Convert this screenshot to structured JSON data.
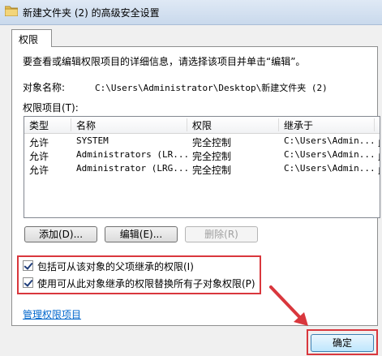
{
  "window": {
    "title": "新建文件夹 (2) 的高级安全设置"
  },
  "tabs": [
    {
      "label": "权限"
    }
  ],
  "instructions": "要查看或编辑权限项目的详细信息，请选择该项目并单击“编辑”。",
  "object_name": {
    "label": "对象名称:",
    "value": "C:\\Users\\Administrator\\Desktop\\新建文件夹 (2)"
  },
  "permission_entries_label": "权限项目(T):",
  "table": {
    "columns": [
      "类型",
      "名称",
      "权限",
      "继承于",
      "应"
    ],
    "rows": [
      {
        "type": "允许",
        "name": "SYSTEM",
        "permission": "完全控制",
        "inherited": "C:\\Users\\Admin...",
        "apply": "此"
      },
      {
        "type": "允许",
        "name": "Administrators (LR...",
        "permission": "完全控制",
        "inherited": "C:\\Users\\Admin...",
        "apply": "此"
      },
      {
        "type": "允许",
        "name": "Administrator (LRG...",
        "permission": "完全控制",
        "inherited": "C:\\Users\\Admin...",
        "apply": "此"
      }
    ]
  },
  "buttons": {
    "add": "添加(D)...",
    "edit": "编辑(E)...",
    "delete": "删除(R)",
    "ok": "确定"
  },
  "checkboxes": [
    {
      "label": "包括可从该对象的父项继承的权限(I)",
      "checked": true
    },
    {
      "label": "使用可从此对象继承的权限替换所有子对象权限(P)",
      "checked": true
    }
  ],
  "manage_link": "管理权限项目",
  "colors": {
    "highlight": "#d9373d",
    "link": "#0066cc"
  }
}
